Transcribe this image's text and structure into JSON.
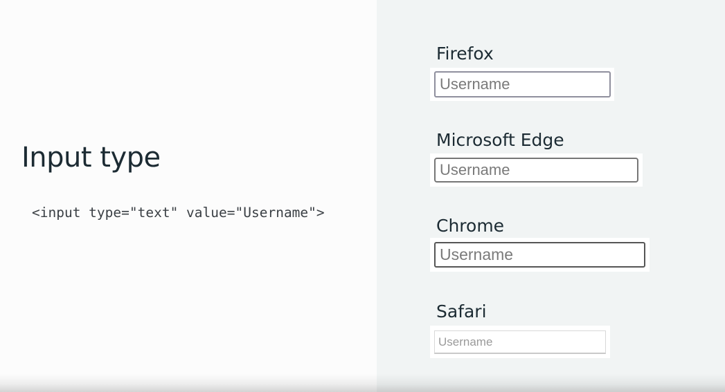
{
  "slide": {
    "title": "Input type",
    "code": "<input type=\"text\" value=\"Username\">"
  },
  "browsers": [
    {
      "name": "Firefox",
      "value": "Username"
    },
    {
      "name": "Microsoft Edge",
      "value": "Username"
    },
    {
      "name": "Chrome",
      "value": "Username"
    },
    {
      "name": "Safari",
      "value": "Username"
    }
  ],
  "colors": {
    "left_background": "#fcfcfc",
    "right_background": "#f1f4f4",
    "text": "#1c2b33"
  }
}
